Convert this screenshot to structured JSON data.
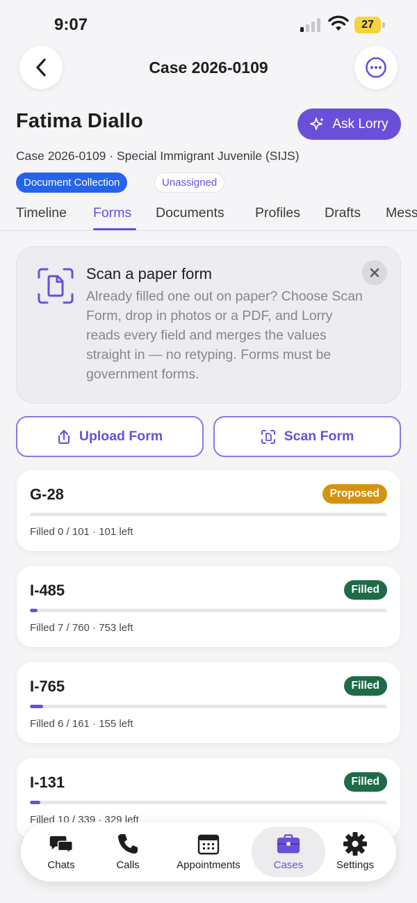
{
  "status_bar": {
    "time": "9:07",
    "battery": "27"
  },
  "header": {
    "title": "Case 2026-0109"
  },
  "client": {
    "name": "Fatima Diallo",
    "ask_label": "Ask Lorry",
    "case_line": "Case 2026-0109 · Special Immigrant Juvenile (SIJS)",
    "stage_badge": "Document Collection",
    "assignee_badge": "Unassigned"
  },
  "tabs": [
    "Timeline",
    "Forms",
    "Documents",
    "Profiles",
    "Drafts",
    "Mess"
  ],
  "scan_card": {
    "title": "Scan a paper form",
    "body": "Already filled one out on paper? Choose Scan Form, drop in photos or a PDF, and Lorry reads every field and merges the values straight in — no retyping. Forms must be government forms."
  },
  "actions": {
    "upload_label": "Upload Form",
    "scan_label": "Scan Form"
  },
  "forms": [
    {
      "name": "G-28",
      "status": "Proposed",
      "status_color": "#d4930f",
      "progress": 0.0,
      "meta": "Filled 0 / 101  ·  101 left"
    },
    {
      "name": "I-485",
      "status": "Filled",
      "status_color": "#1e6b48",
      "progress": 0.021,
      "meta": "Filled 7 / 760  ·  753 left"
    },
    {
      "name": "I-765",
      "status": "Filled",
      "status_color": "#1e6b48",
      "progress": 0.037,
      "meta": "Filled 6 / 161  ·  155 left"
    },
    {
      "name": "I-131",
      "status": "Filled",
      "status_color": "#1e6b48",
      "progress": 0.029,
      "meta": "Filled 10 / 339  ·  329 left"
    }
  ],
  "tabbar": {
    "chats": "Chats",
    "calls": "Calls",
    "appointments": "Appointments",
    "cases": "Cases",
    "settings": "Settings"
  },
  "colors": {
    "accent": "#6b4fd8",
    "blue_badge": "#2563eb",
    "filled": "#1e6b48",
    "proposed": "#d4930f"
  }
}
